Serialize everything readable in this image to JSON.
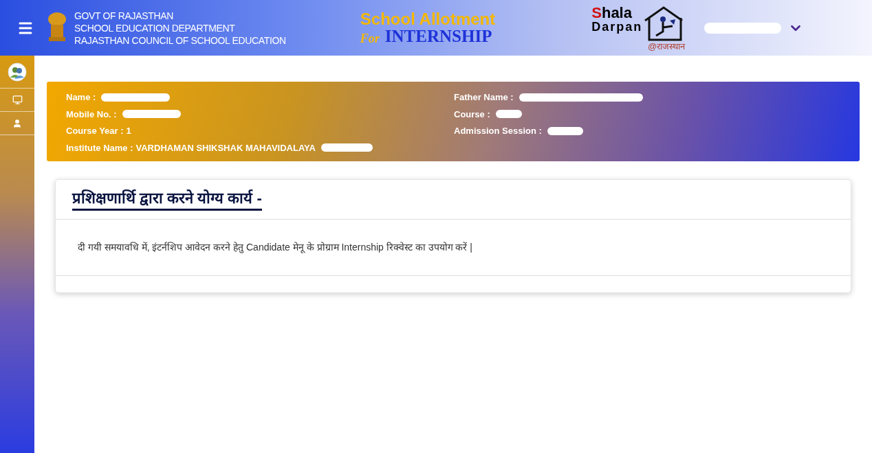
{
  "header": {
    "org_lines": [
      "GOVT OF RAJASTHAN",
      "SCHOOL EDUCATION DEPARTMENT",
      "RAJASTHAN COUNCIL OF SCHOOL EDUCATION"
    ],
    "app_title": {
      "line1": "School Allotment",
      "for": "For",
      "line2": "INTERNSHIP"
    },
    "logo": {
      "word1": "Shala",
      "word2": "Darpan",
      "tag": "@राजस्थान"
    },
    "user_menu": {
      "name_redacted": true
    }
  },
  "sidebar": {
    "items": [
      {
        "kind": "avatar"
      },
      {
        "kind": "monitor"
      },
      {
        "kind": "user"
      }
    ]
  },
  "profile": {
    "left": [
      {
        "label": "Name :",
        "redacted": true
      },
      {
        "label": "Mobile No. :",
        "redacted": true
      },
      {
        "label": "Course Year :",
        "value": "1",
        "redacted": false
      },
      {
        "label": "Institute Name :",
        "value": "VARDHAMAN SHIKSHAK MAHAVIDALAYA",
        "redacted": true
      }
    ],
    "right": [
      {
        "label": "Father Name :",
        "redacted": true
      },
      {
        "label": "Course :",
        "redacted": true
      },
      {
        "label": "Admission Session :",
        "redacted": true
      }
    ]
  },
  "task_card": {
    "title": "प्रशिक्षणार्थि द्वारा करने योग्य कार्य -",
    "message": "दी गयी समयावधि में, इंटर्नशिप आवेदन करने हेतु Candidate मेनू के प्रोग्राम Internship रिक्वेस्ट का उपयोग करें |"
  }
}
